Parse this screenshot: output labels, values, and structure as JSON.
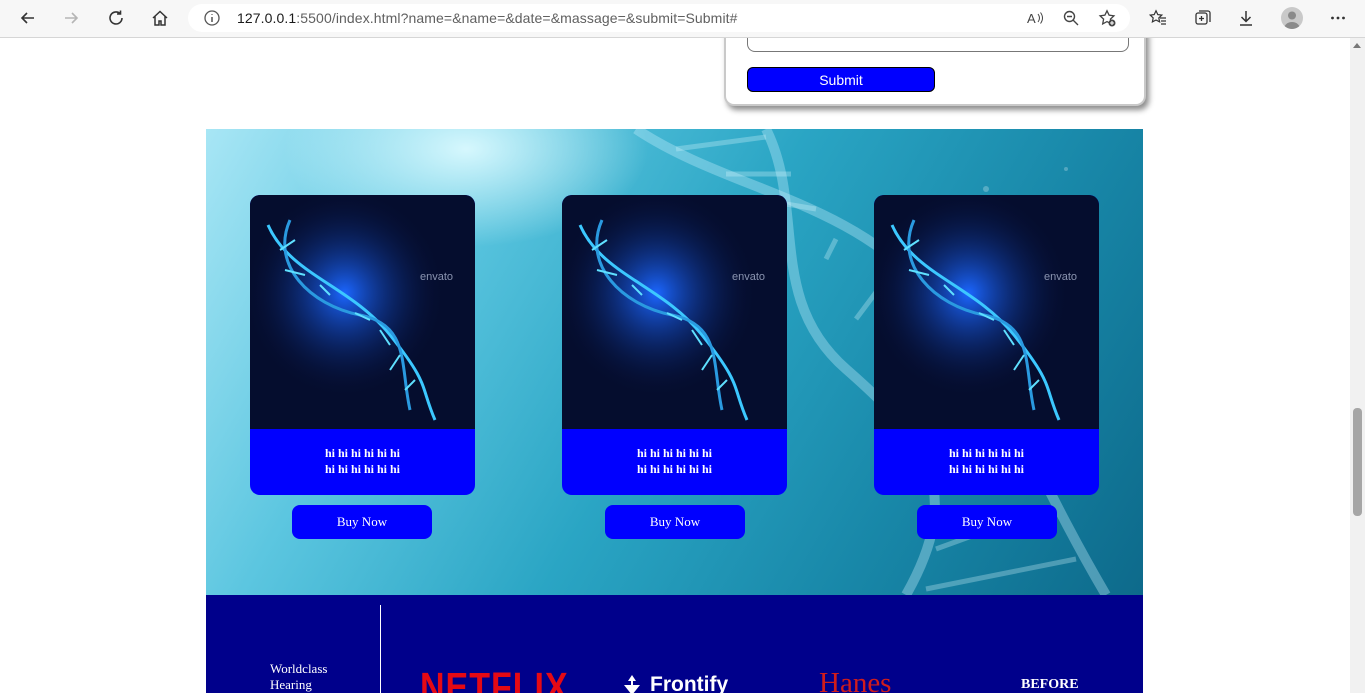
{
  "browser": {
    "url_host": "127.0.0.1",
    "url_rest": ":5500/index.html?name=&name=&date=&massage=&submit=Submit#"
  },
  "form": {
    "submit_label": "Submit"
  },
  "products": [
    {
      "text_line1": "hi hi hi hi hi hi",
      "text_line2": "hi hi hi hi hi hi",
      "button": "Buy Now",
      "image_watermark": "envato"
    },
    {
      "text_line1": "hi hi hi hi hi hi",
      "text_line2": "hi hi hi hi hi hi",
      "button": "Buy Now",
      "image_watermark": "envato"
    },
    {
      "text_line1": "hi hi hi hi hi hi",
      "text_line2": "hi hi hi hi hi hi",
      "button": "Buy Now",
      "image_watermark": "envato"
    }
  ],
  "footer": {
    "brand_text": "Worldclass Hearing",
    "logos": [
      "NETFLIX",
      "Frontify",
      "Hanes",
      "BEFORE"
    ]
  },
  "colors": {
    "accent_blue": "#0000ff",
    "footer_navy": "#00008b",
    "netflix_red": "#e50914"
  }
}
